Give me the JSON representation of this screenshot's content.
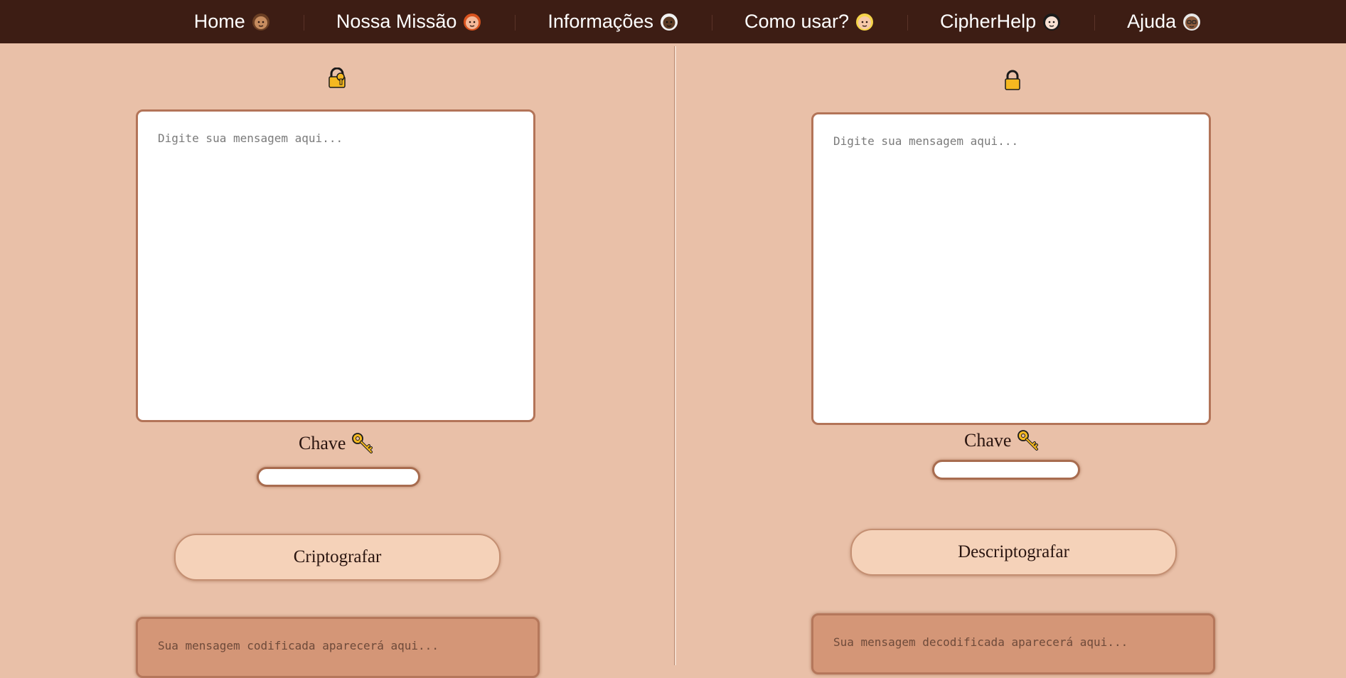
{
  "nav": {
    "items": [
      {
        "label": "Home",
        "icon": "woman-medium-skin-icon"
      },
      {
        "label": "Nossa Missão",
        "icon": "woman-red-hair-icon"
      },
      {
        "label": "Informações",
        "icon": "woman-white-hair-dark-skin-icon"
      },
      {
        "label": "Como usar?",
        "icon": "woman-blond-icon"
      },
      {
        "label": "CipherHelp",
        "icon": "woman-dark-hair-icon"
      },
      {
        "label": "Ajuda",
        "icon": "old-woman-glasses-icon"
      }
    ]
  },
  "encrypt": {
    "icon": "lock-with-key-icon",
    "message_placeholder": "Digite sua mensagem aqui...",
    "key_label": "Chave",
    "key_icon": "key-icon",
    "key_value": "",
    "button_label": "Criptografar",
    "output_placeholder": "Sua mensagem codificada aparecerá aqui..."
  },
  "decrypt": {
    "icon": "locked-icon",
    "message_placeholder": "Digite sua mensagem aqui...",
    "key_label": "Chave",
    "key_icon": "key-icon",
    "key_value": "",
    "button_label": "Descriptografar",
    "output_placeholder": "Sua mensagem decodificada aparecerá aqui..."
  },
  "colors": {
    "navbar": "#3d1d14",
    "background": "#e9c0a8",
    "button": "#f5d2b9",
    "output": "#d49677",
    "border": "#b37458"
  }
}
